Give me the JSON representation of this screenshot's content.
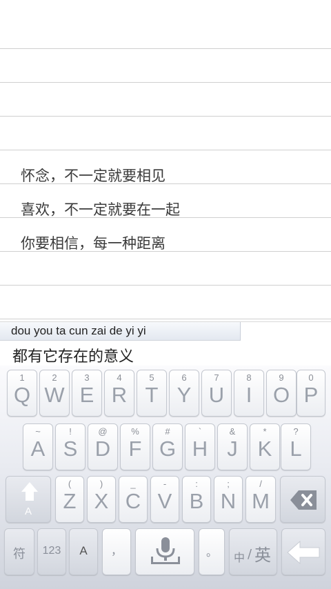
{
  "notepad": {
    "lines": [
      "怀念，不一定就要相见",
      "喜欢，不一定就要在一起",
      "你要相信，每一种距离"
    ]
  },
  "ime": {
    "pinyin": "dou you ta cun zai de yi yi",
    "candidate": "都有它存在的意义"
  },
  "keyboard": {
    "row1": [
      {
        "hint": "1",
        "key": "Q"
      },
      {
        "hint": "2",
        "key": "W"
      },
      {
        "hint": "3",
        "key": "E"
      },
      {
        "hint": "4",
        "key": "R"
      },
      {
        "hint": "5",
        "key": "T"
      },
      {
        "hint": "6",
        "key": "Y"
      },
      {
        "hint": "7",
        "key": "U"
      },
      {
        "hint": "8",
        "key": "I"
      },
      {
        "hint": "9",
        "key": "O"
      },
      {
        "hint": "0",
        "key": "P"
      }
    ],
    "row2": [
      {
        "hint": "~",
        "key": "A"
      },
      {
        "hint": "!",
        "key": "S"
      },
      {
        "hint": "@",
        "key": "D"
      },
      {
        "hint": "%",
        "key": "F"
      },
      {
        "hint": "#",
        "key": "G"
      },
      {
        "hint": "`",
        "key": "H"
      },
      {
        "hint": "&",
        "key": "J"
      },
      {
        "hint": "*",
        "key": "K"
      },
      {
        "hint": "?",
        "key": "L"
      }
    ],
    "row3": [
      {
        "hint": "(",
        "key": "Z"
      },
      {
        "hint": ")",
        "key": "X"
      },
      {
        "hint": "_",
        "key": "C"
      },
      {
        "hint": "-",
        "key": "V"
      },
      {
        "hint": ":",
        "key": "B"
      },
      {
        "hint": ";",
        "key": "N"
      },
      {
        "hint": "/",
        "key": "M"
      }
    ],
    "shift_label": "A",
    "symbols_label": "符",
    "numbers_label": "123",
    "case_label": "A",
    "comma_label": "，",
    "period_label": "。",
    "lang_label_zh": "中",
    "lang_label_en": "英",
    "icons": {
      "shift": "shift-arrow-icon",
      "backspace": "backspace-icon",
      "mic": "microphone-icon",
      "enter": "enter-arrow-icon"
    }
  }
}
